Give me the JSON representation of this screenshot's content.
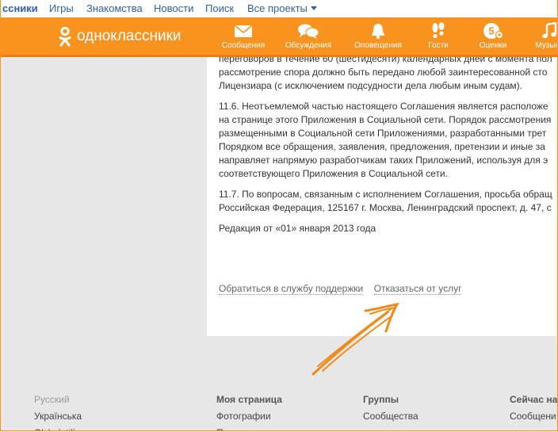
{
  "topbar": {
    "brand": "ссники",
    "links": [
      "Игры",
      "Знакомства",
      "Новости",
      "Поиск"
    ],
    "all_projects": "Все проекты"
  },
  "nav": {
    "logo_text": "одноклассники",
    "items": [
      {
        "label": "Сообщения",
        "icon": "envelope-icon"
      },
      {
        "label": "Обсуждения",
        "icon": "chat-bubbles-icon"
      },
      {
        "label": "Оповещения",
        "icon": "bell-icon"
      },
      {
        "label": "Гости",
        "icon": "footprints-icon"
      },
      {
        "label": "Оценки",
        "icon": "rating-5-icon"
      },
      {
        "label": "Музыка",
        "icon": "music-note-icon"
      }
    ]
  },
  "content": {
    "p1": [
      "переговоров в течение 60 (шестидесяти) календарных дней с момента пол",
      "рассмотрение спора должно быть передано любой заинтересованной сто",
      "Лицензиара (с исключением подсудности дела любым иным судам)."
    ],
    "p2": [
      "11.6. Неотъемлемой частью настоящего Соглашения является расположе",
      "на странице этого Приложения в Социальной сети. Порядок рассмотрения",
      "размещенными в Социальной сети Приложениями, разработанными трет",
      "Порядком все обращения, заявления, предложения, претензии и иные за",
      "направляет напрямую разработчикам таких Приложений, используя для э",
      "соответствующего Приложения в Социальной сети."
    ],
    "p3": [
      "11.7. По вопросам, связанным с исполнением Соглашения, просьба обращ",
      "Российская Федерация, 125167 г. Москва, Ленинградский проспект, д. 47, с"
    ],
    "edition": "Редакция от «01» января 2013 года",
    "support_link": "Обратиться в службу поддержки",
    "refuse_link": "Отказаться от услуг"
  },
  "footer": {
    "lang": {
      "items": [
        "Русский",
        "Українська",
        "O'zbek tili"
      ]
    },
    "my_page": {
      "title": "Моя страница",
      "items": [
        "Фотографии",
        "Поделился"
      ]
    },
    "groups": {
      "title": "Группы",
      "items": [
        "Сообщества"
      ]
    },
    "now": {
      "title": "Сейчас на",
      "items": [
        "Сообщени"
      ]
    }
  },
  "colors": {
    "brand_orange": "#f7931e",
    "link_blue": "#2e5fa8",
    "annotation_arrow": "#f08a1c"
  }
}
